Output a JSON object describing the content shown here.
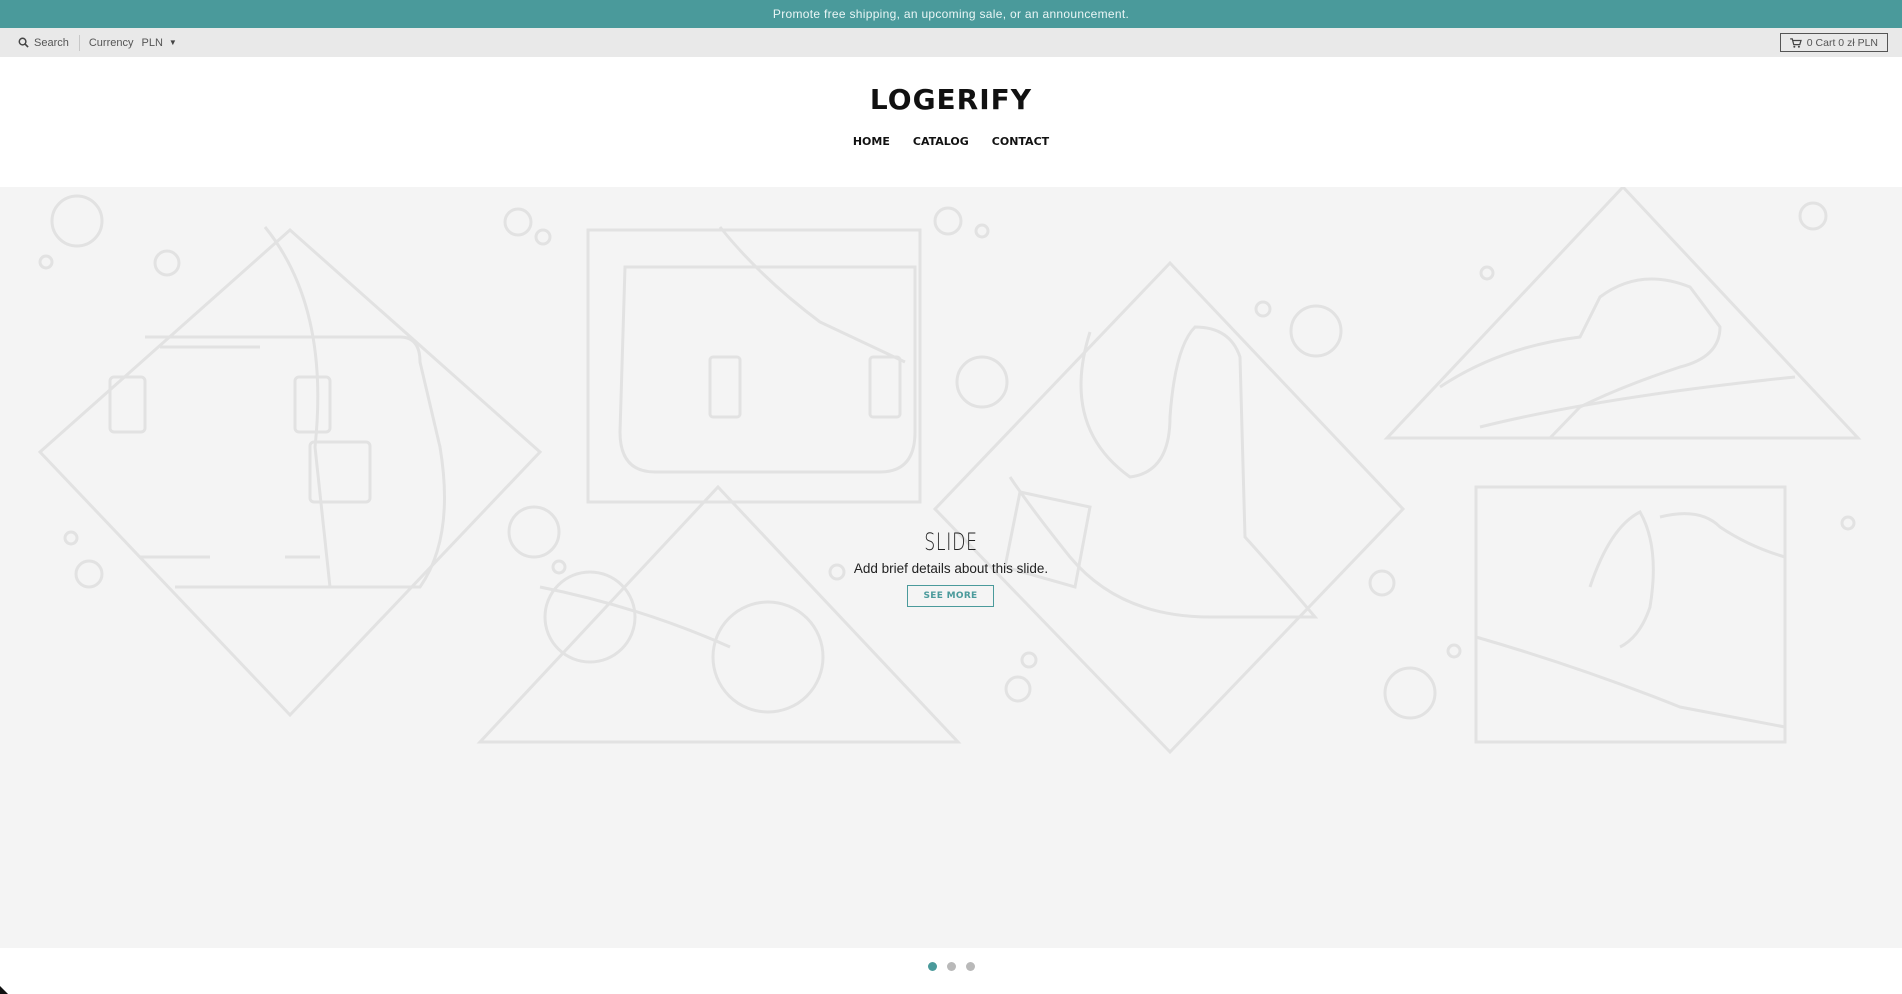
{
  "announcement": {
    "text": "Promote free shipping, an upcoming sale, or an announcement."
  },
  "toolbar": {
    "search_label": "Search",
    "search_icon": "search-icon",
    "currency_label": "Currency",
    "currency_value": "PLN",
    "cart_label": "0 Cart 0 zł PLN",
    "cart_icon": "cart-icon"
  },
  "header": {
    "logo": "LOGERIFY",
    "nav": [
      {
        "label": "HOME"
      },
      {
        "label": "CATALOG"
      },
      {
        "label": "CONTACT"
      }
    ]
  },
  "slideshow": {
    "title": "SLIDE",
    "subtitle": "Add brief details about this slide.",
    "button_label": "SEE MORE",
    "slide_count": 3,
    "active_slide": 1
  },
  "colors": {
    "accent": "#4a9a9b",
    "hero_bg": "#f4f4f4",
    "line_art": "#e2e2e2"
  }
}
